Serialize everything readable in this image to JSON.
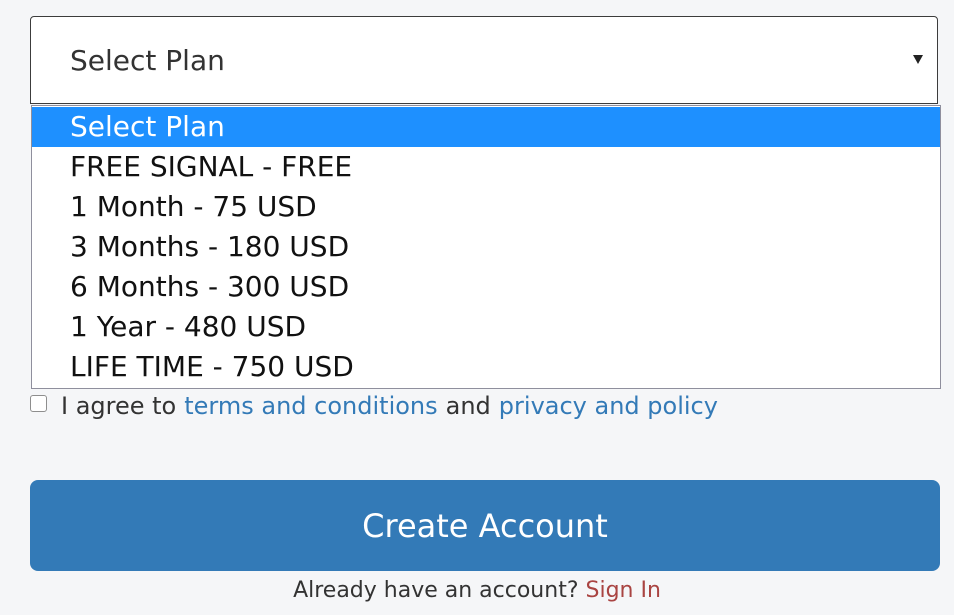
{
  "plan_select": {
    "selected_label": "Select Plan",
    "options": [
      "Select Plan",
      "FREE SIGNAL - FREE",
      "1 Month - 75 USD",
      "3 Months - 180 USD",
      "6 Months - 300 USD",
      "1 Year - 480 USD",
      "LIFE TIME - 750 USD"
    ],
    "highlighted_index": 0,
    "highlight_color": "#1e90ff"
  },
  "agreement": {
    "checked": false,
    "prefix": "I agree to",
    "terms_link": "terms and conditions",
    "middle": "and",
    "privacy_link": "privacy and policy",
    "link_color": "#337ab7"
  },
  "create_button": {
    "label": "Create Account",
    "color": "#337ab7"
  },
  "signin": {
    "prompt": "Already have an account?",
    "link": "Sign In",
    "link_color": "#a94442"
  }
}
